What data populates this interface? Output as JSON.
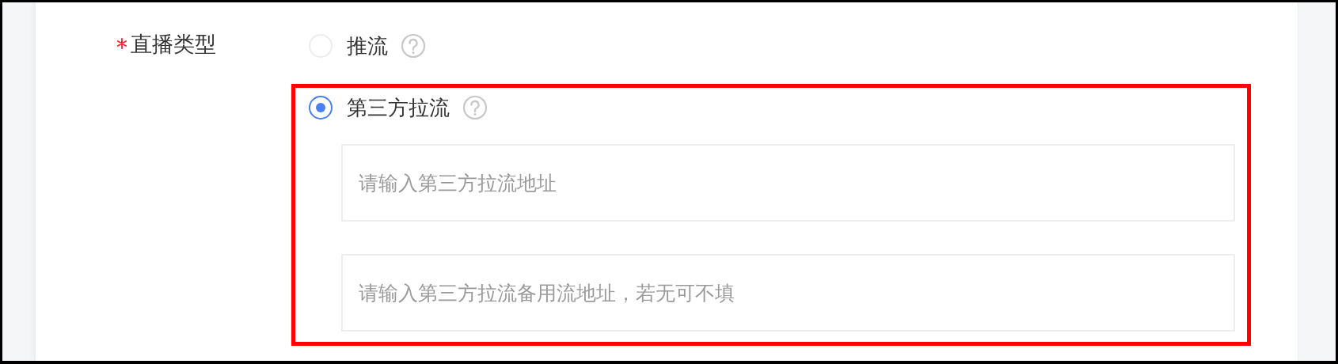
{
  "form_field": {
    "label": "直播类型",
    "required": true,
    "options": [
      {
        "label": "推流",
        "selected": false,
        "help": true,
        "highlighted": false
      },
      {
        "label": "第三方拉流",
        "selected": true,
        "help": true,
        "highlighted": true,
        "inputs": [
          {
            "placeholder": "请输入第三方拉流地址"
          },
          {
            "placeholder": "请输入第三方拉流备用流地址，若无可不填"
          }
        ]
      }
    ]
  }
}
